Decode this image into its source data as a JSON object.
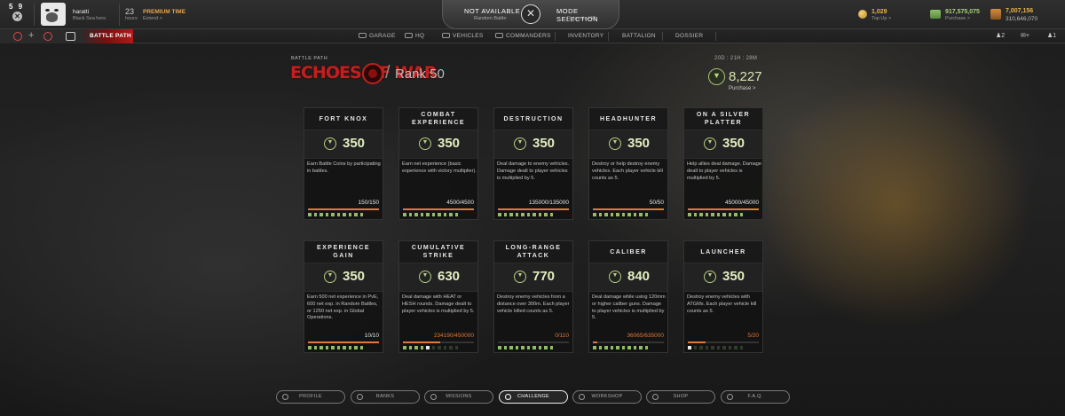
{
  "topbar": {
    "counter": "5 9",
    "close_glyph": "✕",
    "username": "haratti",
    "user_sub": "Black Sea hero",
    "hours_num": "23",
    "hours_label": "hours",
    "premium_title": "PREMIUM TIME",
    "premium_sub": "Extend >",
    "status_title": "NOT AVAILABLE",
    "status_sub": "Random Battle",
    "mode_title": "MODE SELECTION",
    "mode_sub": "Return to HQ",
    "mode_glyph": "✕",
    "gold_value": "1,029",
    "gold_sub": "Top Up >",
    "silver_value": "917,575,075",
    "silver_sub": "Purchase >",
    "xp_value": "7,007,156",
    "xp_value2": "310,646,070"
  },
  "nav": {
    "plus_glyph": "+",
    "battle_path": "BATTLE PATH",
    "items": [
      "GARAGE",
      "HQ",
      "VEHICLES",
      "COMMANDERS",
      "INVENTORY",
      "BATTALION",
      "DOSSIER"
    ],
    "friends_count": "2",
    "chat_count": "+",
    "extra_count": "1"
  },
  "header": {
    "label": "BATTLE PATH",
    "logo_text": "ECHOES OF WAR",
    "slash": "/",
    "rank": "Rank 50",
    "timer": "20D : 21H : 28M",
    "points": "8,227",
    "purchase": "Purchase >"
  },
  "cards": [
    {
      "title": "FORT KNOX",
      "reward": "350",
      "desc": "Earn Battle Coins by participating in battles.",
      "progress": "150/150",
      "fill": 1.0,
      "complete": true,
      "pips_on": 10
    },
    {
      "title": "COMBAT EXPERIENCE",
      "reward": "350",
      "desc": "Earn net experience (basic experience with victory multiplier).",
      "progress": "4500/4500",
      "fill": 1.0,
      "complete": true,
      "pips_on": 10
    },
    {
      "title": "DESTRUCTION",
      "reward": "350",
      "desc": "Deal damage to enemy vehicles. Damage dealt to player vehicles is multiplied by 5.",
      "progress": "135000/135000",
      "fill": 1.0,
      "complete": true,
      "pips_on": 10
    },
    {
      "title": "HEADHUNTER",
      "reward": "350",
      "desc": "Destroy or help destroy enemy vehicles. Each player vehicle kill counts as 5.",
      "progress": "50/50",
      "fill": 1.0,
      "complete": true,
      "pips_on": 10
    },
    {
      "title": "ON A SILVER PLATTER",
      "reward": "350",
      "desc": "Help allies deal damage. Damage dealt to player vehicles is multiplied by 5.",
      "progress": "45000/45000",
      "fill": 1.0,
      "complete": true,
      "pips_on": 10
    },
    {
      "title": "EXPERIENCE GAIN",
      "reward": "350",
      "desc": "Earn 500 net experience in PvE, 600 net exp. in Random Battles, or 1250 net exp. in Global Operations.",
      "progress": "10/10",
      "fill": 1.0,
      "complete": true,
      "pips_on": 10
    },
    {
      "title": "CUMULATIVE STRIKE",
      "reward": "630",
      "desc": "Deal damage with HEAT or HESH rounds. Damage dealt to player vehicles is multiplied by 5.",
      "progress": "234190/450000",
      "fill": 0.52,
      "complete": false,
      "pips_on": 5
    },
    {
      "title": "LONG-RANGE ATTACK",
      "reward": "770",
      "desc": "Destroy enemy vehicles from a distance over 300m. Each player vehicle killed counts as 5.",
      "progress": "0/110",
      "fill": 0.0,
      "complete": false,
      "pips_on": 10
    },
    {
      "title": "CALIBER",
      "reward": "840",
      "desc": "Deal damage while using 120mm or higher caliber guns. Damage to player vehicles is multiplied by 5.",
      "progress": "36065/635000",
      "fill": 0.06,
      "complete": false,
      "pips_on": 10
    },
    {
      "title": "LAUNCHER",
      "reward": "350",
      "desc": "Destroy enemy vehicles with ATGMs. Each player vehicle kill counts as 5.",
      "progress": "5/20",
      "fill": 0.25,
      "complete": false,
      "pips_on": 1
    }
  ],
  "bottom_nav": [
    "PROFILE",
    "RANKS",
    "MISSIONS",
    "CHALLENGE",
    "WORKSHOP",
    "SHOP",
    "F.A.Q."
  ],
  "colors": {
    "accent_red": "#c1201e",
    "reward_green": "#b5cc84",
    "progress_orange": "#e07a3a",
    "complete_white": "#e8e8e8"
  }
}
